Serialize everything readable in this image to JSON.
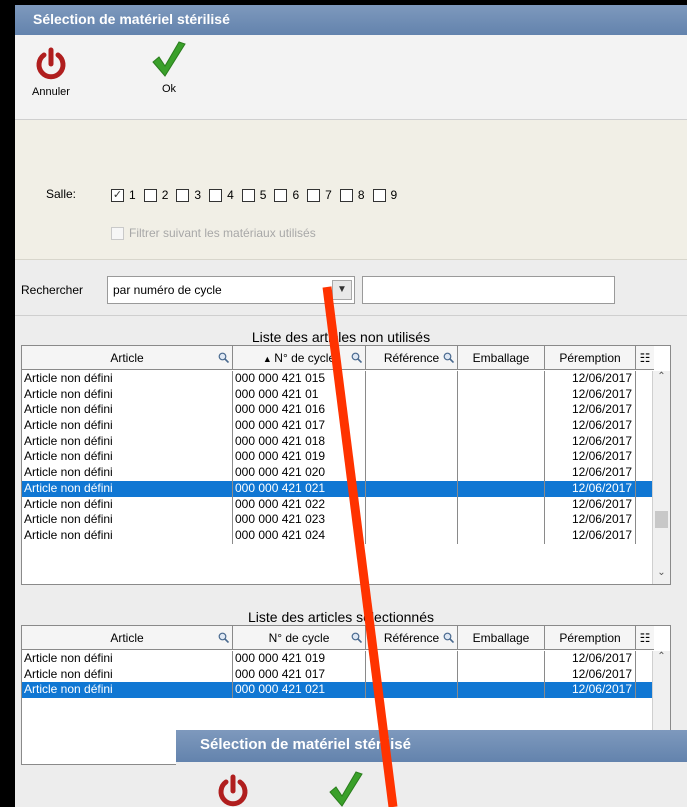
{
  "window": {
    "title": "Sélection de matériel stérilisé",
    "toolbar": {
      "cancel_label": "Annuler",
      "ok_label": "Ok"
    }
  },
  "filters": {
    "salle_label": "Salle:",
    "rooms": [
      {
        "label": "1",
        "checked": true
      },
      {
        "label": "2",
        "checked": false
      },
      {
        "label": "3",
        "checked": false
      },
      {
        "label": "4",
        "checked": false
      },
      {
        "label": "5",
        "checked": false
      },
      {
        "label": "6",
        "checked": false
      },
      {
        "label": "7",
        "checked": false
      },
      {
        "label": "8",
        "checked": false
      },
      {
        "label": "9",
        "checked": false
      }
    ],
    "filter_used_label": "Filtrer suivant les matériaux utilisés"
  },
  "search": {
    "label": "Rechercher",
    "mode_value": "par numéro de cycle",
    "query_value": ""
  },
  "unused_table": {
    "caption": "Liste des articles non utilisés",
    "columns": [
      "Article",
      "N° de cycle",
      "Référence",
      "Emballage",
      "Péremption"
    ],
    "rows": [
      [
        "Article non défini",
        "000 000 421 015",
        "",
        "",
        "12/06/2017"
      ],
      [
        "Article non défini",
        "000 000 421 01",
        "",
        "",
        "12/06/2017"
      ],
      [
        "Article non défini",
        "000 000 421 016",
        "",
        "",
        "12/06/2017"
      ],
      [
        "Article non défini",
        "000 000 421 017",
        "",
        "",
        "12/06/2017"
      ],
      [
        "Article non défini",
        "000 000 421 018",
        "",
        "",
        "12/06/2017"
      ],
      [
        "Article non défini",
        "000 000 421 019",
        "",
        "",
        "12/06/2017"
      ],
      [
        "Article non défini",
        "000 000 421 020",
        "",
        "",
        "12/06/2017"
      ],
      [
        "Article non défini",
        "000 000 421 021",
        "",
        "",
        "12/06/2017"
      ],
      [
        "Article non défini",
        "000 000 421 022",
        "",
        "",
        "12/06/2017"
      ],
      [
        "Article non défini",
        "000 000 421 023",
        "",
        "",
        "12/06/2017"
      ],
      [
        "Article non défini",
        "000 000 421 024",
        "",
        "",
        "12/06/2017"
      ]
    ],
    "selected_row": 7
  },
  "selected_table": {
    "caption": "Liste des articles sélectionnés",
    "columns": [
      "Article",
      "N° de cycle",
      "Référence",
      "Emballage",
      "Péremption"
    ],
    "rows": [
      [
        "Article non défini",
        "000 000 421 019",
        "",
        "",
        "12/06/2017"
      ],
      [
        "Article non défini",
        "000 000 421 017",
        "",
        "",
        "12/06/2017"
      ],
      [
        "Article non défini",
        "000 000 421 021",
        "",
        "",
        "12/06/2017"
      ]
    ],
    "selected_row": 2
  },
  "window2": {
    "title": "Sélection de matériel stérilisé"
  },
  "colors": {
    "titlebar": "#6f8cb3",
    "selection": "#1077d3",
    "annotation": "#ff3300",
    "cancel_icon": "#b01e1e",
    "ok_icon": "#3aa02a"
  }
}
